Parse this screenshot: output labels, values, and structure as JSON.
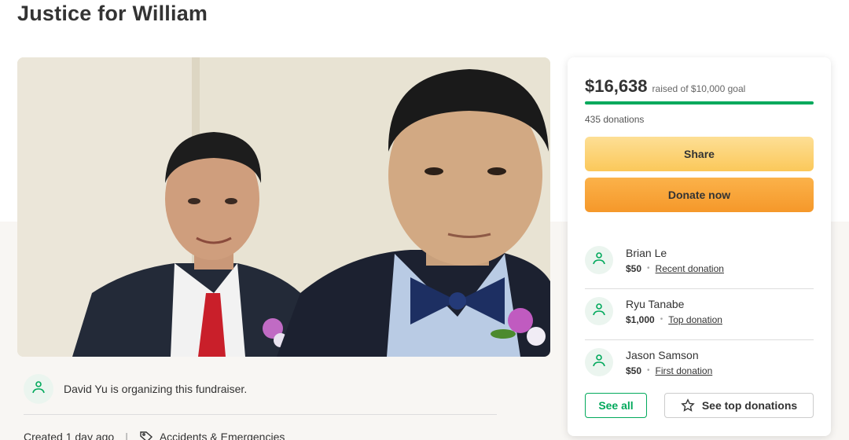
{
  "page": {
    "title": "Justice for William"
  },
  "organizer": {
    "text": "David Yu is organizing this fundraiser.",
    "icon": "heart-hand-icon"
  },
  "meta": {
    "created": "Created 1 day ago",
    "separator": "|",
    "category": "Accidents & Emergencies",
    "category_icon": "tag-icon"
  },
  "donation_card": {
    "amount": "$16,638",
    "goal_text": "raised of $10,000 goal",
    "progress_percent": 100,
    "donation_count": "435 donations",
    "share_label": "Share",
    "donate_label": "Donate now",
    "donors": [
      {
        "name": "Brian Le",
        "amount": "$50",
        "tag": "Recent donation"
      },
      {
        "name": "Ryu Tanabe",
        "amount": "$1,000",
        "tag": "Top donation"
      },
      {
        "name": "Jason Samson",
        "amount": "$50",
        "tag": "First donation"
      }
    ],
    "see_all_label": "See all",
    "see_top_label": "See top donations",
    "colors": {
      "accent": "#02a95c",
      "share_button": "#fbc85a",
      "donate_button": "#f5982a"
    }
  }
}
